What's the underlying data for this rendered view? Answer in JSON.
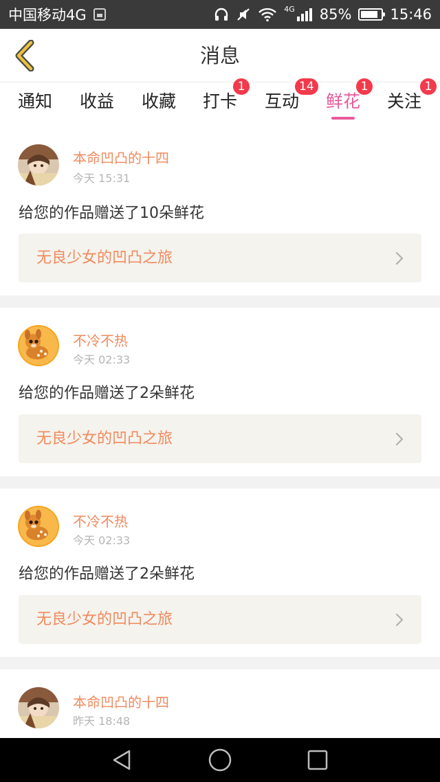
{
  "status_bar": {
    "carrier": "中国移动4G",
    "network": "4G",
    "battery": "85%",
    "battery_level": 0.85,
    "time": "15:46",
    "icons": [
      "gallery-icon",
      "headphones-icon",
      "mute-icon",
      "wifi-icon",
      "signal-icon",
      "battery-icon"
    ]
  },
  "header": {
    "title": "消息",
    "back_icon": "chevron-left-icon"
  },
  "tabs": [
    {
      "label": "通知",
      "badge": "",
      "active": false
    },
    {
      "label": "收益",
      "badge": "",
      "active": false
    },
    {
      "label": "收藏",
      "badge": "",
      "active": false
    },
    {
      "label": "打卡",
      "badge": "1",
      "active": false
    },
    {
      "label": "互动",
      "badge": "14",
      "active": false
    },
    {
      "label": "鲜花",
      "badge": "1",
      "active": true
    },
    {
      "label": "关注",
      "badge": "1",
      "active": false
    }
  ],
  "notifications": [
    {
      "user": "本命凹凸的十四",
      "time": "今天 15:31",
      "message": "给您的作品赠送了10朵鲜花",
      "work": "无良少女的凹凸之旅",
      "avatar": "anime-character-avatar"
    },
    {
      "user": "不冷不热",
      "time": "今天 02:33",
      "message": "给您的作品赠送了2朵鲜花",
      "work": "无良少女的凹凸之旅",
      "avatar": "fawn-avatar"
    },
    {
      "user": "不冷不热",
      "time": "今天 02:33",
      "message": "给您的作品赠送了2朵鲜花",
      "work": "无良少女的凹凸之旅",
      "avatar": "fawn-avatar"
    },
    {
      "user": "本命凹凸的十四",
      "time": "昨天 18:48",
      "message": "",
      "work": "",
      "avatar": "anime-character-avatar"
    }
  ],
  "colors": {
    "accent": "#e85a9b",
    "badge": "#f23a4c",
    "username": "#f08a5d",
    "back_icon": "#e9c23a"
  },
  "nav_bar": {
    "icons": [
      "back-triangle-icon",
      "home-circle-icon",
      "recents-square-icon"
    ]
  }
}
